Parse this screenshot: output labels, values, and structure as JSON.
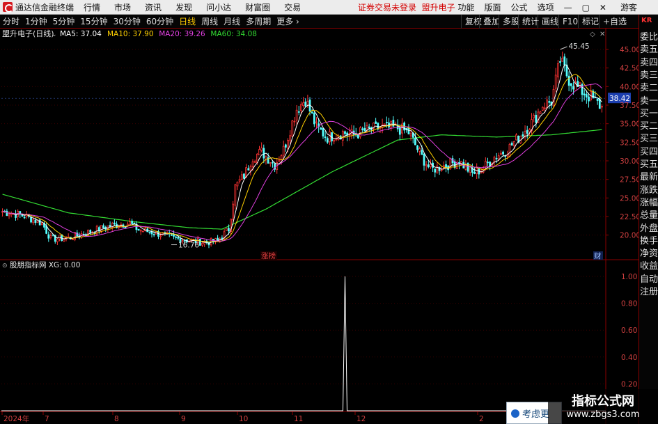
{
  "menubar": {
    "app_title": "通达信金融终端",
    "menus": [
      "行情",
      "市场",
      "资讯",
      "发现",
      "问小达",
      "财富圈",
      "交易"
    ],
    "warning": "证券交易未登录",
    "stock_name": "盟升电子",
    "right_menus": [
      "功能",
      "版面",
      "公式",
      "选项"
    ],
    "guest": "游客"
  },
  "toolbar": {
    "periods": [
      "分时",
      "1分钟",
      "5分钟",
      "15分钟",
      "30分钟",
      "60分钟",
      "日线",
      "周线",
      "月线",
      "多周期",
      "更多"
    ],
    "active_period": "日线",
    "buttons": [
      "复权",
      "叠加",
      "多股",
      "统计",
      "画线",
      "F10",
      "标记",
      "+自选"
    ]
  },
  "main_panel": {
    "title": "盟升电子(日线)",
    "ma": [
      {
        "label": "MA5: 37.04",
        "color": "#ffffff"
      },
      {
        "label": "MA10: 37.90",
        "color": "#ffd000"
      },
      {
        "label": "MA20: 39.26",
        "color": "#e040e0"
      },
      {
        "label": "MA60: 34.08",
        "color": "#33dd33"
      }
    ],
    "high_label": "45.45",
    "low_label": "16.76",
    "tag_zhangbang": "涨榜",
    "tag_cai": "财",
    "current_price": "38.42",
    "y_ticks": [
      "45.00",
      "42.50",
      "40.00",
      "37.50",
      "35.00",
      "32.50",
      "30.00",
      "27.50",
      "25.00",
      "22.50",
      "20.00"
    ]
  },
  "sub_panel": {
    "title": "股朋指标网 XG: 0.00",
    "y_ticks": [
      "1.00",
      "0.80",
      "0.60",
      "0.40",
      "0.20"
    ]
  },
  "x_axis": [
    "2024年",
    "7",
    "8",
    "9",
    "10",
    "11",
    "12",
    "2"
  ],
  "side_strip": {
    "top": "KR",
    "items": [
      "委比",
      "卖五",
      "卖四",
      "卖三",
      "卖二",
      "卖一",
      "买一",
      "买二",
      "买三",
      "买四",
      "买五",
      "最新",
      "涨跌",
      "涨幅",
      "总量",
      "外盘",
      "换手",
      "净资",
      "收益",
      "自动",
      "注册"
    ]
  },
  "notice": "考虑更",
  "watermark": {
    "line1": "指标公式网",
    "line2": "www.zbgs3.com"
  },
  "colors": {
    "up": "#ff3232",
    "down": "#54ffff",
    "ma5": "#ffffff",
    "ma10": "#ffd000",
    "ma20": "#e040e0",
    "ma60": "#33dd33",
    "signal": "#ffffff"
  },
  "chart_data": {
    "type": "candlestick",
    "ylim": [
      18.0,
      46.5
    ],
    "anchors": [
      [
        0,
        23.2
      ],
      [
        10,
        22.6
      ],
      [
        18,
        21.6
      ],
      [
        22,
        19.5
      ],
      [
        30,
        19.6
      ],
      [
        40,
        20.5
      ],
      [
        50,
        21.3
      ],
      [
        58,
        21.6
      ],
      [
        62,
        20.7
      ],
      [
        70,
        20.3
      ],
      [
        78,
        19.6
      ],
      [
        85,
        19.3
      ],
      [
        92,
        19.0
      ],
      [
        98,
        19.2
      ],
      [
        103,
        20.8
      ],
      [
        106,
        26.5
      ],
      [
        110,
        28.0
      ],
      [
        114,
        30.5
      ],
      [
        118,
        31.2
      ],
      [
        124,
        29.5
      ],
      [
        128,
        31.5
      ],
      [
        134,
        37.0
      ],
      [
        138,
        38.3
      ],
      [
        143,
        34.5
      ],
      [
        148,
        33.2
      ],
      [
        155,
        33.8
      ],
      [
        160,
        33.5
      ],
      [
        165,
        34.0
      ],
      [
        172,
        34.5
      ],
      [
        180,
        34.4
      ],
      [
        185,
        33.8
      ],
      [
        191,
        30.5
      ],
      [
        195,
        28.8
      ],
      [
        203,
        29.5
      ],
      [
        208,
        30.0
      ],
      [
        214,
        28.3
      ],
      [
        218,
        28.8
      ],
      [
        224,
        30.5
      ],
      [
        230,
        31.5
      ],
      [
        236,
        33.5
      ],
      [
        242,
        35.5
      ],
      [
        246,
        37.5
      ],
      [
        250,
        38.0
      ],
      [
        254,
        43.5
      ],
      [
        258,
        41.0
      ],
      [
        262,
        39.8
      ],
      [
        268,
        38.5
      ],
      [
        273,
        37.2
      ]
    ],
    "ma60_anchors": [
      [
        0,
        25.5
      ],
      [
        30,
        23.0
      ],
      [
        60,
        21.8
      ],
      [
        85,
        21.0
      ],
      [
        100,
        20.8
      ],
      [
        120,
        23.5
      ],
      [
        150,
        28.5
      ],
      [
        180,
        32.8
      ],
      [
        200,
        33.5
      ],
      [
        225,
        33.2
      ],
      [
        250,
        33.5
      ],
      [
        273,
        34.2
      ]
    ],
    "signal_x": 156,
    "signal_value": 1.0,
    "sub_ylim": [
      0,
      1.0
    ]
  }
}
